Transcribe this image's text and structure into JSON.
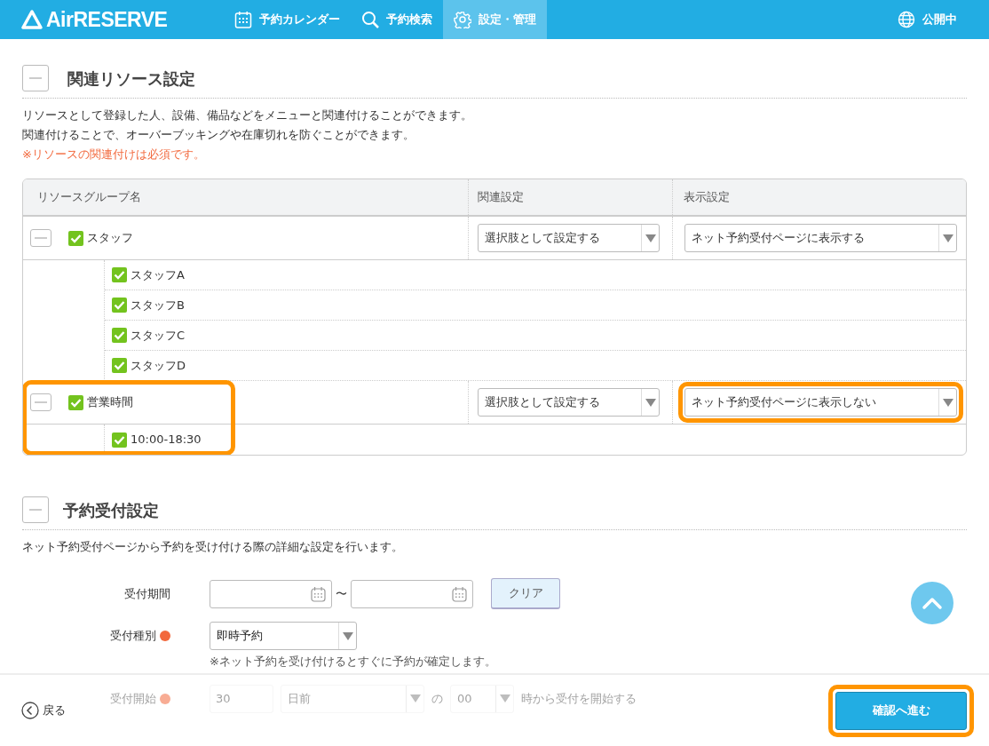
{
  "header": {
    "logo": "AirRESERVE",
    "tabs": [
      {
        "label": "予約カレンダー",
        "kind": "calendar",
        "selected": false
      },
      {
        "label": "予約検索",
        "kind": "search",
        "selected": false
      },
      {
        "label": "設定・管理",
        "kind": "gear",
        "selected": true
      }
    ],
    "status": "公開中"
  },
  "resource_section": {
    "title": "関連リソース設定",
    "expanded": true,
    "description": [
      "リソースとして登録した人、設備、備品などをメニューと関連付けることができます。",
      "関連付けることで、オーバーブッキングや在庫切れを防ぐことができます。"
    ],
    "required_note": "※リソースの関連付けは必須です。",
    "columns": [
      "リソースグループ名",
      "関連設定",
      "表示設定"
    ],
    "groups": [
      {
        "name": "スタッフ",
        "expanded": true,
        "checked": true,
        "link_setting": "選択肢として設定する",
        "display_setting": "ネット予約受付ページに表示する",
        "highlighted": false,
        "display_highlighted": false,
        "members": [
          {
            "name": "スタッフA",
            "checked": true
          },
          {
            "name": "スタッフB",
            "checked": true
          },
          {
            "name": "スタッフC",
            "checked": true
          },
          {
            "name": "スタッフD",
            "checked": true
          }
        ]
      },
      {
        "name": "営業時間",
        "expanded": true,
        "checked": true,
        "link_setting": "選択肢として設定する",
        "display_setting": "ネット予約受付ページに表示しない",
        "highlighted": true,
        "display_highlighted": true,
        "members": [
          {
            "name": "10:00-18:30",
            "checked": true
          }
        ]
      }
    ]
  },
  "reservation_section": {
    "title": "予約受付設定",
    "expanded": true,
    "description": "ネット予約受付ページから予約を受け付ける際の詳細な設定を行います。",
    "period": {
      "label": "受付期間",
      "required": false,
      "separator": "〜",
      "clear_button": "クリア"
    },
    "type": {
      "label": "受付種別",
      "required": true,
      "value": "即時予約",
      "note": "※ネット予約を受け付けるとすぐに予約が確定します。"
    },
    "start": {
      "label": "受付開始",
      "required": true,
      "days": "30",
      "unit": "日前",
      "of": "の",
      "hour": "00",
      "suffix": "時から受付を開始する"
    }
  },
  "footer": {
    "back": "戻る",
    "confirm": "確認へ進む",
    "confirm_highlighted": true
  }
}
